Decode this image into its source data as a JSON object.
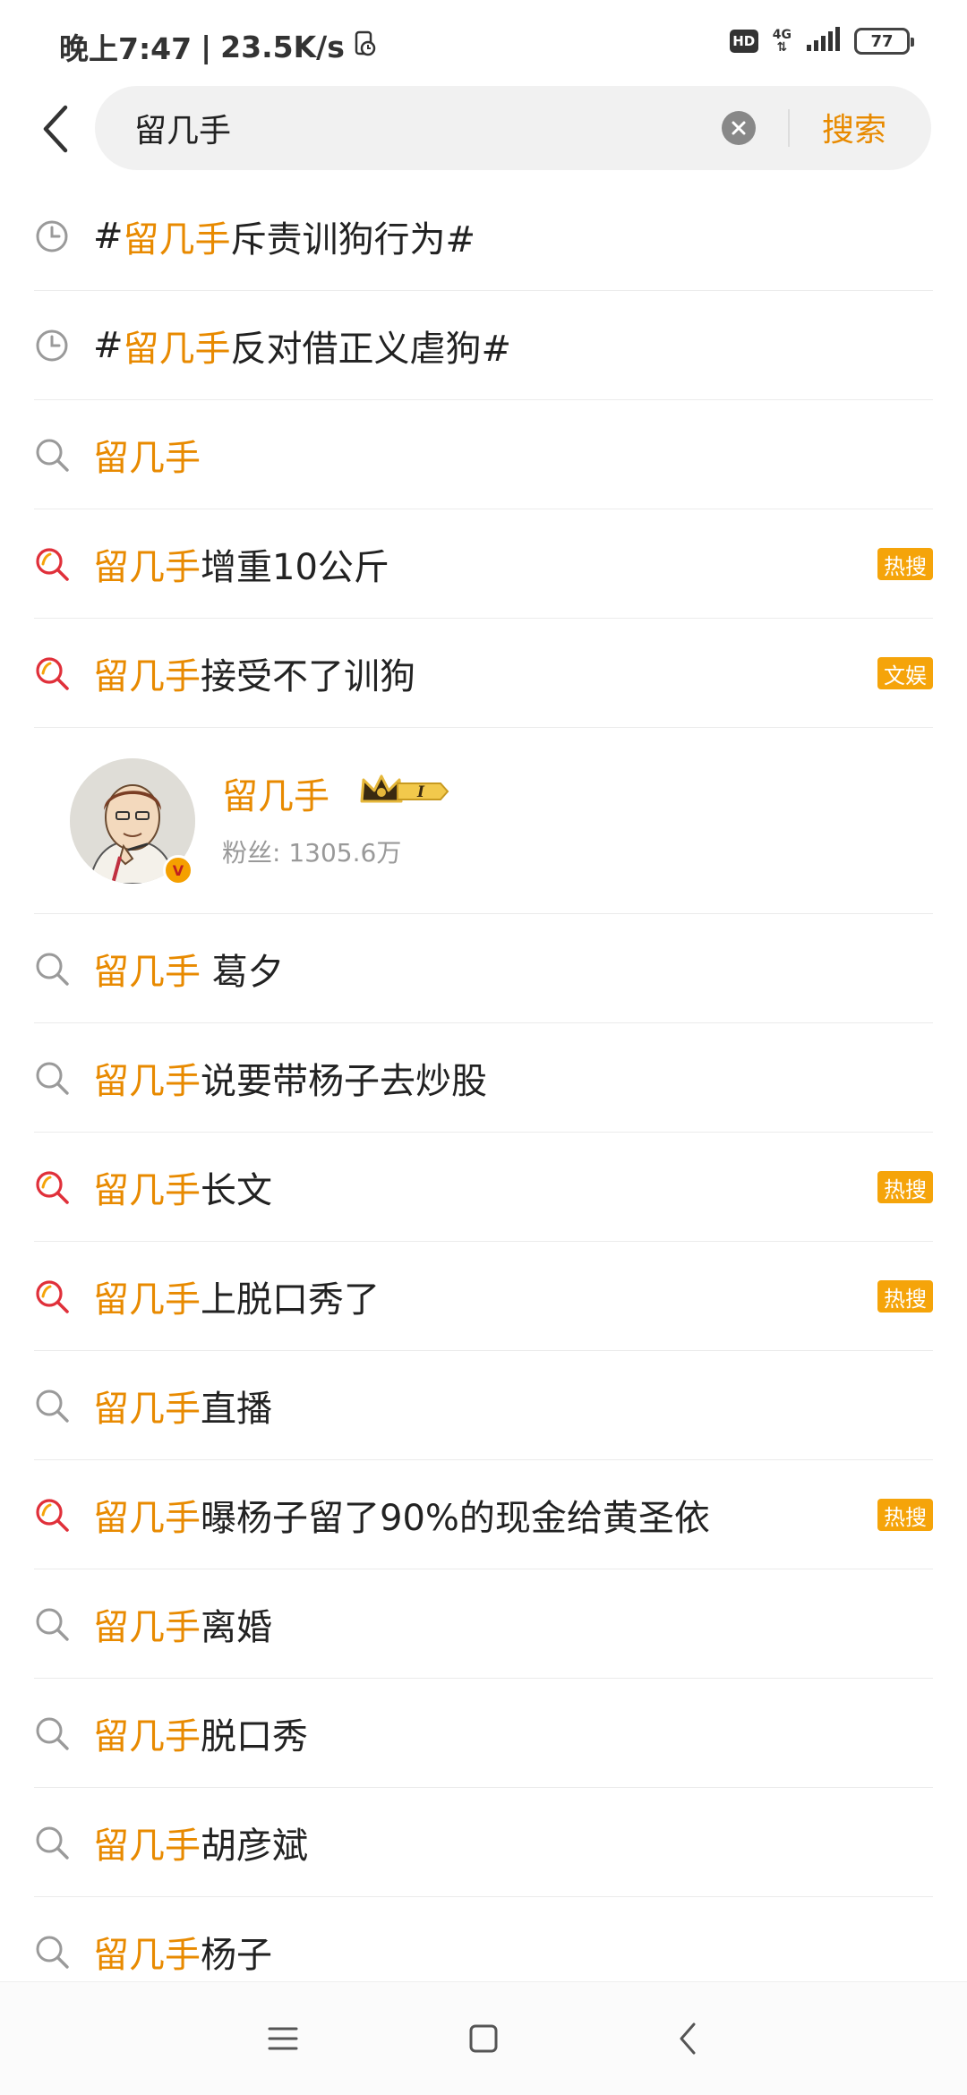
{
  "status_bar": {
    "time": "晚上7:47",
    "speed": "23.5K/s",
    "hd": "HD",
    "network": "4G",
    "battery": "77"
  },
  "search": {
    "query": "留几手",
    "button_label": "搜索"
  },
  "suggestions_top": [
    {
      "type": "history",
      "keyword": "留几手",
      "prefix": "#",
      "suffix": "斥责训狗行为#",
      "tag": ""
    },
    {
      "type": "history",
      "keyword": "留几手",
      "prefix": "#",
      "suffix": "反对借正义虐狗#",
      "tag": ""
    },
    {
      "type": "search",
      "keyword": "留几手",
      "prefix": "",
      "suffix": "",
      "tag": ""
    },
    {
      "type": "hot",
      "keyword": "留几手",
      "prefix": "",
      "suffix": "增重10公斤",
      "tag": "热搜"
    },
    {
      "type": "hot",
      "keyword": "留几手",
      "prefix": "",
      "suffix": "接受不了训狗",
      "tag": "文娱"
    }
  ],
  "account": {
    "name": "留几手",
    "level": "I",
    "fans_label": "粉丝: ",
    "fans_count": "1305.6万"
  },
  "suggestions_bottom": [
    {
      "type": "search",
      "keyword": "留几手",
      "suffix": " 葛夕",
      "tag": ""
    },
    {
      "type": "search",
      "keyword": "留几手",
      "suffix": "说要带杨子去炒股",
      "tag": ""
    },
    {
      "type": "hot",
      "keyword": "留几手",
      "suffix": "长文",
      "tag": "热搜"
    },
    {
      "type": "hot",
      "keyword": "留几手",
      "suffix": "上脱口秀了",
      "tag": "热搜"
    },
    {
      "type": "search",
      "keyword": "留几手",
      "suffix": "直播",
      "tag": ""
    },
    {
      "type": "hot",
      "keyword": "留几手",
      "suffix": "曝杨子留了90%的现金给黄圣依",
      "tag": "热搜"
    },
    {
      "type": "search",
      "keyword": "留几手",
      "suffix": "离婚",
      "tag": ""
    },
    {
      "type": "search",
      "keyword": "留几手",
      "suffix": "脱口秀",
      "tag": ""
    },
    {
      "type": "search",
      "keyword": "留几手",
      "suffix": "胡彦斌",
      "tag": ""
    },
    {
      "type": "search",
      "keyword": "留几手",
      "suffix": "杨子",
      "tag": ""
    }
  ],
  "colors": {
    "accent": "#e88a00",
    "tag_bg": "#f5a40a",
    "hot_icon": "#e0303a"
  },
  "icons": {
    "history": "clock-icon",
    "search": "search-icon",
    "hot": "hot-search-icon",
    "back": "back-arrow-icon",
    "clear": "clear-icon",
    "nav_menu": "menu-icon",
    "nav_home": "home-square-icon",
    "nav_back": "nav-back-icon"
  }
}
